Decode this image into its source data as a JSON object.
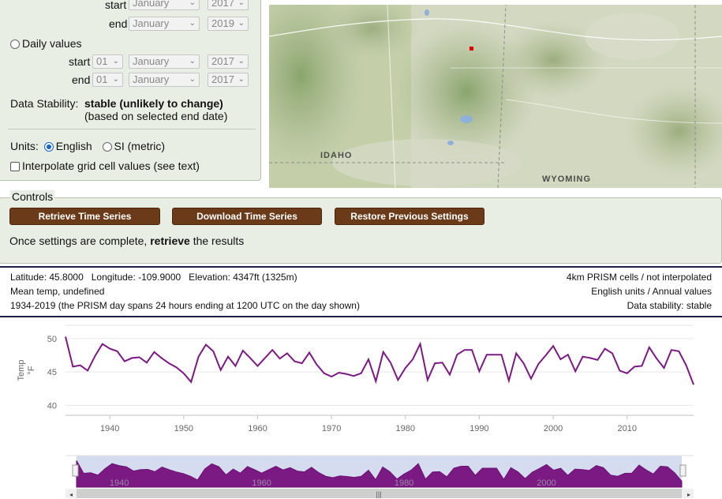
{
  "period": {
    "top_start_label": "start",
    "top_start_month": "January",
    "top_start_year": "2017",
    "top_end_label": "end",
    "top_end_month": "January",
    "top_end_year": "2019",
    "daily_label": "Daily values",
    "daily_start_label": "start",
    "daily_start_day": "01",
    "daily_start_month": "January",
    "daily_start_year": "2017",
    "daily_end_label": "end",
    "daily_end_day": "01",
    "daily_end_month": "January",
    "daily_end_year": "2017"
  },
  "stability": {
    "label": "Data Stability:",
    "value": "stable (unlikely to change)",
    "note": "(based on selected end date)"
  },
  "units": {
    "label": "Units:",
    "english": "English",
    "si": "SI (metric)"
  },
  "interpolate": {
    "label": "Interpolate grid cell values (see text)"
  },
  "map": {
    "labels": {
      "idaho": "IDAHO",
      "wyoming": "WYOMING"
    }
  },
  "controls": {
    "legend": "Controls",
    "retrieve": "Retrieve Time Series",
    "download": "Download Time Series",
    "restore": "Restore Previous Settings",
    "msg_prefix": "Once settings are complete,",
    "msg_bold": "retrieve",
    "msg_suffix": "the results"
  },
  "info": {
    "location": "Latitude: 45.8000   Longitude: -109.9000   Elevation: 4347ft (1325m)",
    "variable": "Mean temp, undefined",
    "span": "1934-2019 (the PRISM day spans 24 hours ending at 1200 UTC on the day shown)",
    "cells": "4km PRISM cells / not interpolated",
    "units_summary": "English units / Annual values",
    "stability": "Data stability: stable"
  },
  "chart_data": {
    "type": "line",
    "ylabel": "Temp",
    "yunit": "°F",
    "xlim": [
      1934,
      2019
    ],
    "ylim": [
      38.5,
      52
    ],
    "yticks": [
      40,
      45,
      50
    ],
    "xticks": [
      1940,
      1950,
      1960,
      1970,
      1980,
      1990,
      2000,
      2010
    ],
    "navigator_ticks": [
      1940,
      1960,
      1980,
      2000
    ],
    "color": "#7b1a83",
    "grid": true,
    "series": [
      {
        "x": [
          1934,
          1935,
          1936,
          1937,
          1938,
          1939,
          1940,
          1941,
          1942,
          1943,
          1944,
          1945,
          1946,
          1947,
          1948,
          1949,
          1950,
          1951,
          1952,
          1953,
          1954,
          1955,
          1956,
          1957,
          1958,
          1959,
          1960,
          1961,
          1962,
          1963,
          1964,
          1965,
          1966,
          1967,
          1968,
          1969,
          1970,
          1971,
          1972,
          1973,
          1974,
          1975,
          1976,
          1977,
          1978,
          1979,
          1980,
          1981,
          1982,
          1983,
          1984,
          1985,
          1986,
          1987,
          1988,
          1989,
          1990,
          1991,
          1992,
          1993,
          1994,
          1995,
          1996,
          1997,
          1998,
          1999,
          2000,
          2001,
          2002,
          2003,
          2004,
          2005,
          2006,
          2007,
          2008,
          2009,
          2010,
          2011,
          2012,
          2013,
          2014,
          2015,
          2016,
          2017,
          2018,
          2019
        ],
        "values": [
          50.3,
          45.8,
          46.0,
          45.2,
          47.4,
          49.2,
          48.5,
          48.1,
          46.6,
          47.1,
          47.2,
          46.4,
          48.0,
          47.1,
          46.3,
          45.7,
          44.8,
          43.5,
          47.3,
          49.1,
          48.1,
          45.3,
          47.3,
          45.9,
          48.2,
          47.1,
          45.9,
          47.1,
          48.3,
          47.0,
          47.8,
          46.6,
          46.3,
          47.9,
          46.1,
          44.8,
          44.3,
          44.9,
          44.7,
          44.4,
          44.8,
          46.9,
          43.6,
          48.0,
          46.4,
          43.8,
          45.6,
          46.9,
          49.2,
          43.8,
          46.3,
          46.4,
          44.6,
          47.6,
          48.3,
          48.3,
          45.1,
          47.6,
          47.6,
          47.6,
          43.7,
          47.8,
          46.3,
          44.0,
          46.2,
          47.5,
          48.9,
          46.9,
          47.6,
          45.1,
          47.3,
          47.1,
          46.8,
          48.5,
          47.8,
          45.2,
          44.8,
          45.8,
          45.9,
          48.7,
          47.0,
          45.6,
          48.3,
          48.1,
          46.0,
          43.1
        ]
      }
    ]
  }
}
